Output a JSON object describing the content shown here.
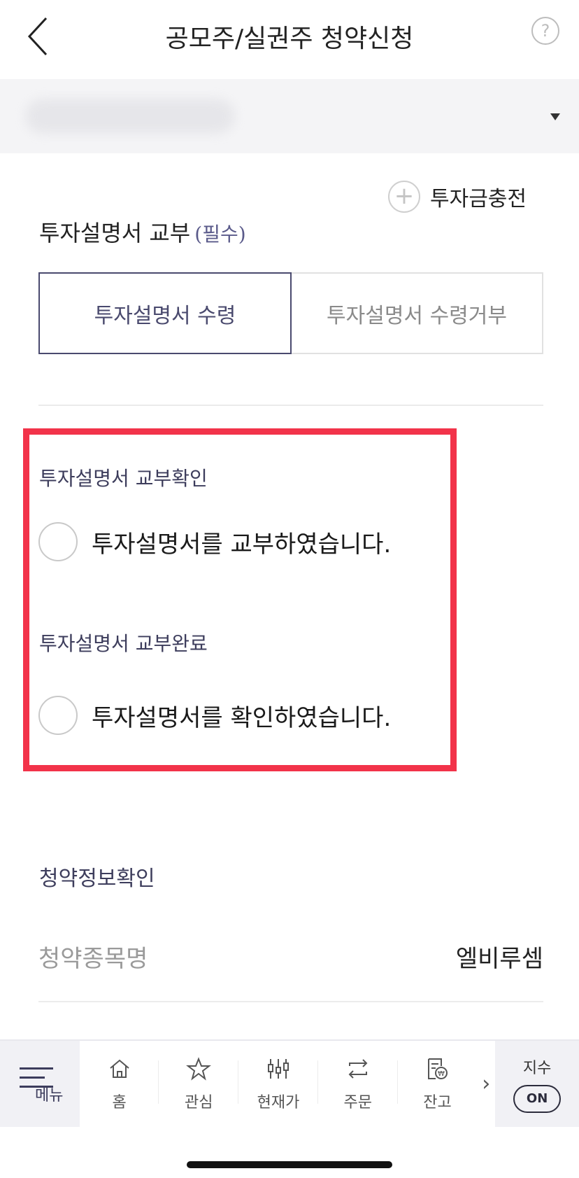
{
  "header": {
    "title": "공모주/실권주 청약신청",
    "help_glyph": "?"
  },
  "charge": {
    "plus_glyph": "+",
    "label": "투자금충전"
  },
  "prospectus": {
    "title": "투자설명서 교부",
    "required": "(필수)",
    "options": [
      "투자설명서 수령",
      "투자설명서 수령거부"
    ],
    "selected_index": 0
  },
  "confirm": {
    "delivery_title": "투자설명서 교부확인",
    "delivery_text": "투자설명서를 교부하였습니다.",
    "complete_title": "투자설명서 교부완료",
    "complete_text": "투자설명서를 확인하였습니다."
  },
  "info": {
    "title": "청약정보확인",
    "stock_label": "청약종목명",
    "stock_value": "엘비루셈"
  },
  "tabbar": {
    "menu": "메뉴",
    "tabs": [
      "홈",
      "관심",
      "현재가",
      "주문",
      "잔고"
    ],
    "more_glyph": "›",
    "index_label": "지수",
    "index_toggle": "ON"
  },
  "colors": {
    "accent": "#4a4a6e",
    "highlight": "#f2334a"
  }
}
